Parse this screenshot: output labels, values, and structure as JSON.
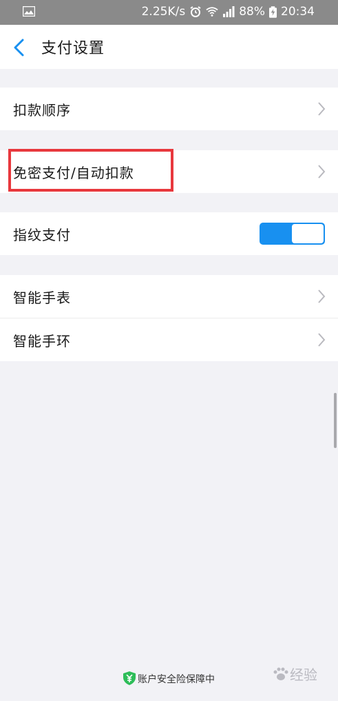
{
  "status_bar": {
    "speed": "2.25K/s",
    "battery": "88%",
    "time": "20:34",
    "icons": [
      "image-icon",
      "alarm-icon",
      "wifi-icon",
      "signal-icon",
      "battery-charging-icon"
    ]
  },
  "header": {
    "title": "支付设置",
    "back_icon": "chevron-left-icon"
  },
  "settings": {
    "deduction_order": "扣款顺序",
    "password_free": "免密支付/自动扣款",
    "fingerprint": "指纹支付",
    "fingerprint_enabled": true,
    "smart_watch": "智能手表",
    "smart_band": "智能手环"
  },
  "footer": {
    "security_text": "账户安全险保障中",
    "icon": "shield-yen-icon"
  },
  "watermark": {
    "text": "经验"
  },
  "colors": {
    "accent": "#1890f0",
    "highlight": "#e8383d",
    "shield": "#2ebd59"
  }
}
